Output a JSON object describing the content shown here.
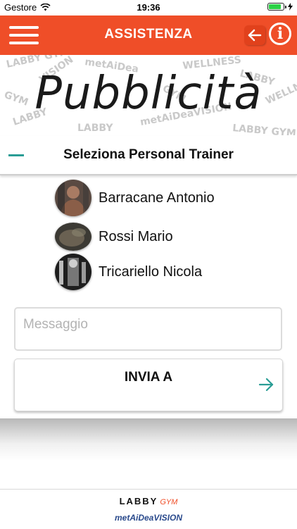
{
  "status_bar": {
    "carrier": "Gestore",
    "time": "19:36",
    "wifi_icon": "wifi-icon",
    "battery_level": 0.85,
    "charging_icon": "bolt-icon"
  },
  "header": {
    "title": "ASSISTENZA",
    "menu_icon": "hamburger-icon",
    "back_icon": "arrow-left-icon",
    "info_icon": "info-icon",
    "info_glyph": "i",
    "bg_color": "#ef4e28"
  },
  "banner": {
    "text": "Pubblicità"
  },
  "section": {
    "title": "Seleziona Personal Trainer",
    "collapse_icon": "minus-icon",
    "accent_color": "#2a9d95"
  },
  "trainers": [
    {
      "name": "Barracane Antonio"
    },
    {
      "name": "Rossi Mario"
    },
    {
      "name": "Tricariello Nicola"
    }
  ],
  "message": {
    "placeholder": "Messaggio",
    "value": ""
  },
  "send": {
    "label": "INVIA A",
    "icon": "arrow-right-icon"
  },
  "footer": {
    "logo_main": "LABBY",
    "logo_sub": "GYM",
    "logo_partner": "metAiDeaVISION"
  }
}
